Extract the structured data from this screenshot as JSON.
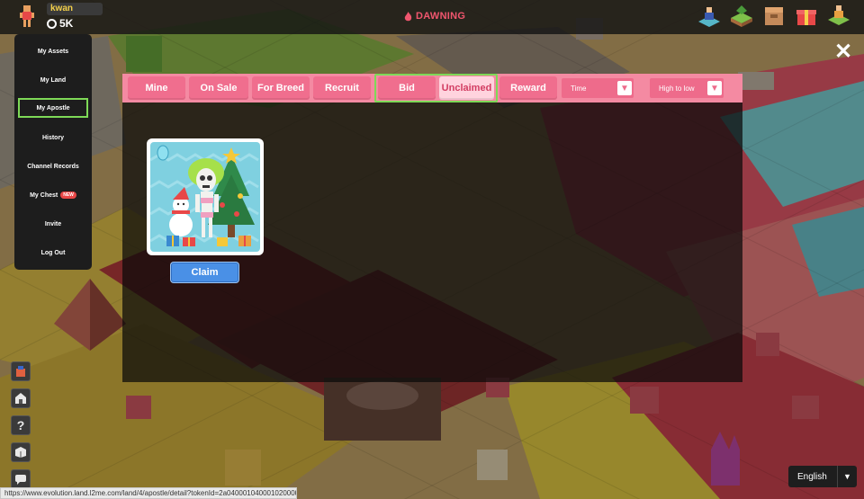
{
  "header": {
    "username": "kwan",
    "balance": "5K",
    "era": "DAWNING",
    "icons": [
      "character-icon",
      "land-plot-icon",
      "inventory-icon",
      "gift-icon",
      "map-icon"
    ]
  },
  "sidebar": {
    "items": [
      {
        "label": "My Assets"
      },
      {
        "label": "My Land"
      },
      {
        "label": "My Apostle",
        "active": true
      },
      {
        "label": "History"
      },
      {
        "label": "Channel Records"
      },
      {
        "label": "My Chest",
        "badge": "NEW"
      },
      {
        "label": "Invite"
      },
      {
        "label": "Log Out"
      }
    ]
  },
  "panel": {
    "tabs": [
      "Mine",
      "On Sale",
      "For Breed",
      "Recruit",
      "Bid",
      "Unclaimed",
      "Reward"
    ],
    "active_tab": "Unclaimed",
    "sort_field": "Time",
    "sort_order": "High to low",
    "claim_label": "Claim"
  },
  "footer": {
    "status_url": "https://www.evolution.land.l2me.com/land/4/apostle/detail?tokenId=2a040001040001020000...",
    "language": "English"
  },
  "colors": {
    "tab_bar": "#f48aa2",
    "tab": "#f06e8e",
    "active_frame": "#7ed957",
    "claim": "#4a90e6",
    "era": "#f0566e"
  }
}
